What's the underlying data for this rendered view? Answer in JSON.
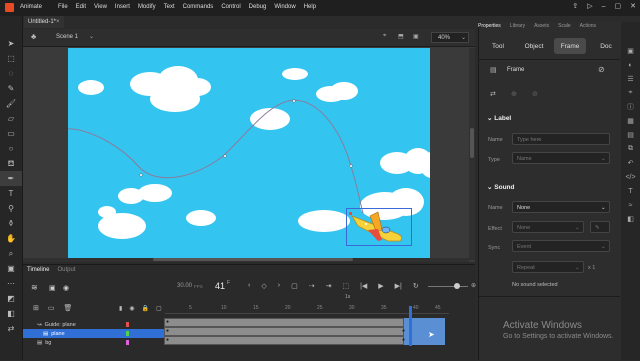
{
  "app": {
    "name": "Animate"
  },
  "menu": [
    "File",
    "Edit",
    "View",
    "Insert",
    "Modify",
    "Text",
    "Commands",
    "Control",
    "Debug",
    "Window",
    "Help"
  ],
  "document_tab": "Untitled-1*",
  "scene": {
    "label": "Scene 1",
    "zoom": "40%"
  },
  "timeline": {
    "tabs": [
      "Timeline",
      "Output"
    ],
    "fps": "30.00",
    "fps_unit": "FPS",
    "current_frame": "41",
    "ruler": [
      "5",
      "10",
      "15",
      "20",
      "25",
      "30",
      "35",
      "40",
      "45",
      "50"
    ],
    "ruler_seconds": "1s",
    "layers": [
      {
        "name": "Guide: plane"
      },
      {
        "name": "plane"
      },
      {
        "name": "bg"
      }
    ]
  },
  "properties": {
    "panel_tabs": [
      "Properties",
      "Library",
      "Assets",
      "Scale",
      "Actions"
    ],
    "mode_tabs": [
      "Tool",
      "Object",
      "Frame",
      "Doc"
    ],
    "selected_mode": "Frame",
    "frame_title": "Frame",
    "label_section": "Label",
    "name_field": "Name",
    "name_placeholder": "Type here",
    "type_field": "Type",
    "type_value": "Name",
    "sound_section": "Sound",
    "sound_name_field": "Name",
    "sound_name_value": "None",
    "effect_field": "Effect",
    "effect_value": "None",
    "sync_field": "Sync",
    "sync_value": "Event",
    "repeat_value": "Repeat",
    "repeat_count": "x 1",
    "no_sound": "No sound selected"
  },
  "watermark": {
    "line1": "Activate Windows",
    "line2": "Go to Settings to activate Windows."
  }
}
